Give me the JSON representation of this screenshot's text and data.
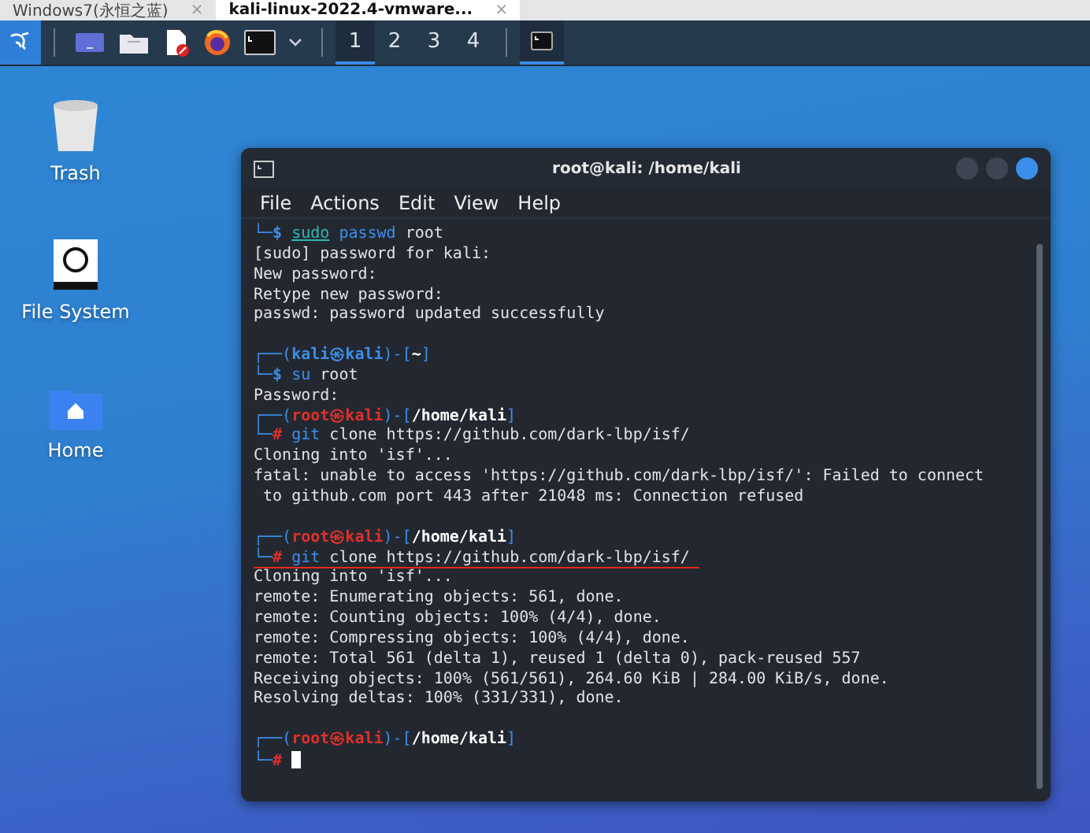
{
  "browser_tabs": [
    {
      "label": "Windows7(永恒之蓝)",
      "close": "×",
      "selected": false
    },
    {
      "label": "kali-linux-2022.4-vmware...",
      "close": "×",
      "selected": true
    }
  ],
  "taskbar": {
    "workspaces": [
      {
        "label": "1",
        "selected": true
      },
      {
        "label": "2",
        "selected": false
      },
      {
        "label": "3",
        "selected": false
      },
      {
        "label": "4",
        "selected": false
      }
    ],
    "terminal_task": {
      "selected": true
    }
  },
  "desktop_icons": [
    {
      "kind": "trash",
      "label": "Trash"
    },
    {
      "kind": "drive",
      "label": "File System"
    },
    {
      "kind": "home",
      "label": "Home"
    }
  ],
  "terminal": {
    "title": "root@kali: /home/kali",
    "menu": [
      "File",
      "Actions",
      "Edit",
      "View",
      "Help"
    ],
    "lines": [
      {
        "kind": "user-command",
        "lead": "└─",
        "symbol": "$",
        "parts": [
          {
            "text": "sudo",
            "kind": "builtin"
          },
          {
            "text": "passwd",
            "kind": "program"
          },
          {
            "text": "root",
            "kind": "argument"
          }
        ],
        "underlined": false
      },
      {
        "kind": "text",
        "text": "[sudo] password for kali:"
      },
      {
        "kind": "text",
        "text": "New password:"
      },
      {
        "kind": "text",
        "text": "Retype new password:"
      },
      {
        "kind": "text",
        "text": "passwd: password updated successfully"
      },
      {
        "kind": "blank"
      },
      {
        "kind": "user-prompt",
        "open": "┌──(",
        "user": "kali",
        "at": "㉿",
        "host": "kali",
        "mid": ")-[",
        "path": "~",
        "close": "]"
      },
      {
        "kind": "user-command",
        "lead": "└─",
        "symbol": "$",
        "parts": [
          {
            "text": "su",
            "kind": "program"
          },
          {
            "text": "root",
            "kind": "argument"
          }
        ],
        "underlined": false
      },
      {
        "kind": "text",
        "text": "Password:"
      },
      {
        "kind": "root-prompt",
        "open": "┌──(",
        "user": "root",
        "at": "㉿",
        "host": "kali",
        "mid": ")-[",
        "path": "/home/kali",
        "close": "]"
      },
      {
        "kind": "root-command",
        "lead": "└─",
        "symbol": "#",
        "parts": [
          {
            "text": "git",
            "kind": "program"
          },
          {
            "text": "clone",
            "kind": "argument"
          },
          {
            "text": "https://github.com/dark-lbp/isf/",
            "kind": "argument"
          }
        ],
        "underlined": false
      },
      {
        "kind": "text",
        "text": "Cloning into 'isf'..."
      },
      {
        "kind": "text",
        "text": "fatal: unable to access 'https://github.com/dark-lbp/isf/': Failed to connect"
      },
      {
        "kind": "text",
        "text": " to github.com port 443 after 21048 ms: Connection refused"
      },
      {
        "kind": "blank"
      },
      {
        "kind": "root-prompt",
        "open": "┌──(",
        "user": "root",
        "at": "㉿",
        "host": "kali",
        "mid": ")-[",
        "path": "/home/kali",
        "close": "]"
      },
      {
        "kind": "root-command",
        "lead": "└─",
        "symbol": "#",
        "parts": [
          {
            "text": "git",
            "kind": "program"
          },
          {
            "text": "clone",
            "kind": "argument"
          },
          {
            "text": "https://github.com/dark-lbp/isf/",
            "kind": "argument"
          }
        ],
        "underlined": true
      },
      {
        "kind": "text",
        "text": "Cloning into 'isf'..."
      },
      {
        "kind": "text",
        "text": "remote: Enumerating objects: 561, done."
      },
      {
        "kind": "text",
        "text": "remote: Counting objects: 100% (4/4), done."
      },
      {
        "kind": "text",
        "text": "remote: Compressing objects: 100% (4/4), done."
      },
      {
        "kind": "text",
        "text": "remote: Total 561 (delta 1), reused 1 (delta 0), pack-reused 557"
      },
      {
        "kind": "text",
        "text": "Receiving objects: 100% (561/561), 264.60 KiB | 284.00 KiB/s, done."
      },
      {
        "kind": "text",
        "text": "Resolving deltas: 100% (331/331), done."
      },
      {
        "kind": "blank"
      },
      {
        "kind": "root-prompt",
        "open": "┌──(",
        "user": "root",
        "at": "㉿",
        "host": "kali",
        "mid": ")-[",
        "path": "/home/kali",
        "close": "]"
      },
      {
        "kind": "root-input",
        "lead": "└─",
        "symbol": "#"
      }
    ]
  }
}
